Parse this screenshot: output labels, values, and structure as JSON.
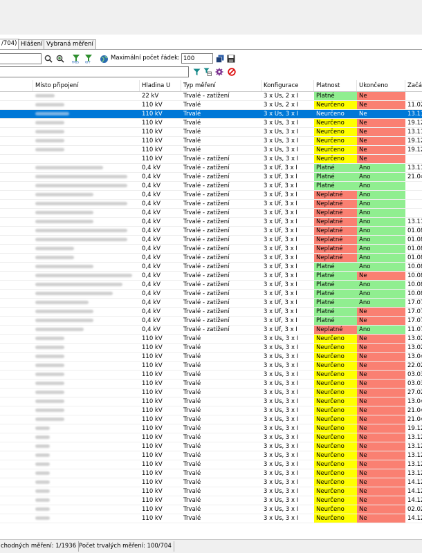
{
  "tabs": [
    {
      "label": "/704)",
      "active": true
    },
    {
      "label": "Hlášení",
      "active": false
    },
    {
      "label": "Vybraná měření",
      "active": false
    }
  ],
  "toolbar": {
    "max_rows_label": "Maximální počet řádek:",
    "max_rows_value": "100",
    "icons": [
      "search-icon",
      "zoom-in-icon",
      "filter-off-icon",
      "filter-off-icon",
      "globe-icon",
      "copy-icon",
      "save-icon",
      "filter-icon",
      "filter-table-icon",
      "settings-icon",
      "cancel-icon"
    ]
  },
  "colors": {
    "selected": "#0078d7",
    "valid": "#90ee90",
    "invalid": "#fa8072",
    "uncertain": "#ffff00"
  },
  "columns": [
    "Místo připojení",
    "Hladina U",
    "Typ měření",
    "Konfigurace",
    "Platnost",
    "Ukončeno",
    "Začát"
  ],
  "rows": [
    {
      "u": "22 kV",
      "typ": "Trvalé - zatížení",
      "konf": "3 x Us, 2 x I",
      "plat": "Platné",
      "ukon": "Ne",
      "zac": "",
      "w": 0.2
    },
    {
      "u": "110 kV",
      "typ": "Trvalé",
      "konf": "3 x Us, 2 x I",
      "plat": "Neurčeno",
      "ukon": "Ne",
      "zac": "11.02",
      "w": 0.3
    },
    {
      "u": "110 kV",
      "typ": "Trvalé",
      "konf": "3 x Us, 3 x I",
      "plat": "Neurčeno",
      "ukon": "Ne",
      "zac": "13.11",
      "w": 0.35,
      "sel": true
    },
    {
      "u": "110 kV",
      "typ": "Trvalé",
      "konf": "3 x Us, 3 x I",
      "plat": "Neurčeno",
      "ukon": "Ne",
      "zac": "19.12",
      "w": 0.3
    },
    {
      "u": "110 kV",
      "typ": "Trvalé",
      "konf": "3 x Us, 3 x I",
      "plat": "Neurčeno",
      "ukon": "Ne",
      "zac": "13.11",
      "w": 0.3
    },
    {
      "u": "110 kV",
      "typ": "Trvalé",
      "konf": "3 x Us, 3 x I",
      "plat": "Neurčeno",
      "ukon": "Ne",
      "zac": "19.12",
      "w": 0.3
    },
    {
      "u": "110 kV",
      "typ": "Trvalé",
      "konf": "3 x Us, 3 x I",
      "plat": "Neurčeno",
      "ukon": "Ne",
      "zac": "19.12",
      "w": 0.3
    },
    {
      "u": "110 kV",
      "typ": "Trvalé - zatížení",
      "konf": "3 x Us, 3 x I",
      "plat": "Neurčeno",
      "ukon": "Ne",
      "zac": "",
      "w": 0
    },
    {
      "u": "0,4 kV",
      "typ": "Trvalé - zatížení",
      "konf": "3 x Uf, 3 x I",
      "plat": "Platné",
      "ukon": "Ano",
      "zac": "13.11",
      "w": 0.7
    },
    {
      "u": "0,4 kV",
      "typ": "Trvalé - zatížení",
      "konf": "3 x Uf, 3 x I",
      "plat": "Platné",
      "ukon": "Ano",
      "zac": "21.04",
      "w": 0.95
    },
    {
      "u": "0,4 kV",
      "typ": "Trvalé - zatížení",
      "konf": "3 x Uf, 3 x I",
      "plat": "Platné",
      "ukon": "Ano",
      "zac": "",
      "w": 0.95
    },
    {
      "u": "0,4 kV",
      "typ": "Trvalé - zatížení",
      "konf": "3 x Uf, 3 x I",
      "plat": "Neplatné",
      "ukon": "Ano",
      "zac": "",
      "w": 0.6
    },
    {
      "u": "0,4 kV",
      "typ": "Trvalé - zatížení",
      "konf": "3 x Uf, 3 x I",
      "plat": "Neplatné",
      "ukon": "Ano",
      "zac": "",
      "w": 0.95
    },
    {
      "u": "0,4 kV",
      "typ": "Trvalé - zatížení",
      "konf": "3 x Uf, 3 x I",
      "plat": "Neplatné",
      "ukon": "Ano",
      "zac": "",
      "w": 0.6
    },
    {
      "u": "0,4 kV",
      "typ": "Trvalé - zatížení",
      "konf": "3 x Uf, 3 x I",
      "plat": "Neplatné",
      "ukon": "Ano",
      "zac": "13.11",
      "w": 0.6
    },
    {
      "u": "0,4 kV",
      "typ": "Trvalé - zatížení",
      "konf": "3 x Uf, 3 x I",
      "plat": "Neplatné",
      "ukon": "Ano",
      "zac": "01.08",
      "w": 0.95
    },
    {
      "u": "0,4 kV",
      "typ": "Trvalé - zatížení",
      "konf": "3 x Uf, 3 x I",
      "plat": "Neplatné",
      "ukon": "Ano",
      "zac": "01.08",
      "w": 0.95
    },
    {
      "u": "0,4 kV",
      "typ": "Trvalé - zatížení",
      "konf": "3 x Uf, 3 x I",
      "plat": "Neplatné",
      "ukon": "Ano",
      "zac": "01.08",
      "w": 0.4
    },
    {
      "u": "0,4 kV",
      "typ": "Trvalé - zatížení",
      "konf": "3 x Uf, 3 x I",
      "plat": "Neplatné",
      "ukon": "Ano",
      "zac": "01.08",
      "w": 0.4
    },
    {
      "u": "0,4 kV",
      "typ": "Trvalé - zatížení",
      "konf": "3 x Uf, 3 x I",
      "plat": "Platné",
      "ukon": "Ano",
      "zac": "10.08",
      "w": 0.6
    },
    {
      "u": "0,4 kV",
      "typ": "Trvalé - zatížení",
      "konf": "3 x Uf, 3 x I",
      "plat": "Platné",
      "ukon": "Ne",
      "zac": "10.08",
      "w": 1.0
    },
    {
      "u": "0,4 kV",
      "typ": "Trvalé - zatížení",
      "konf": "3 x Uf, 3 x I",
      "plat": "Platné",
      "ukon": "Ano",
      "zac": "10.08",
      "w": 0.9
    },
    {
      "u": "0,4 kV",
      "typ": "Trvalé - zatížení",
      "konf": "3 x Uf, 3 x I",
      "plat": "Platné",
      "ukon": "Ano",
      "zac": "10.08",
      "w": 0.8
    },
    {
      "u": "0,4 kV",
      "typ": "Trvalé - zatížení",
      "konf": "3 x Uf, 3 x I",
      "plat": "Platné",
      "ukon": "Ano",
      "zac": "17.07",
      "w": 0.55
    },
    {
      "u": "0,4 kV",
      "typ": "Trvalé - zatížení",
      "konf": "3 x Uf, 3 x I",
      "plat": "Platné",
      "ukon": "Ne",
      "zac": "17.07",
      "w": 0.6
    },
    {
      "u": "0,4 kV",
      "typ": "Trvalé - zatížení",
      "konf": "3 x Uf, 3 x I",
      "plat": "Platné",
      "ukon": "Ne",
      "zac": "17.07",
      "w": 0.6
    },
    {
      "u": "0,4 kV",
      "typ": "Trvalé - zatížení",
      "konf": "3 x Uf, 3 x I",
      "plat": "Neplatné",
      "ukon": "Ano",
      "zac": "11.07",
      "w": 0.5
    },
    {
      "u": "110 kV",
      "typ": "Trvalé",
      "konf": "3 x Us, 3 x I",
      "plat": "Neurčeno",
      "ukon": "Ne",
      "zac": "13.02",
      "w": 0.3
    },
    {
      "u": "110 kV",
      "typ": "Trvalé",
      "konf": "3 x Us, 3 x I",
      "plat": "Neurčeno",
      "ukon": "Ne",
      "zac": "13.02",
      "w": 0.3
    },
    {
      "u": "110 kV",
      "typ": "Trvalé",
      "konf": "3 x Us, 3 x I",
      "plat": "Neurčeno",
      "ukon": "Ne",
      "zac": "13.04",
      "w": 0.3
    },
    {
      "u": "110 kV",
      "typ": "Trvalé",
      "konf": "3 x Us, 3 x I",
      "plat": "Neurčeno",
      "ukon": "Ne",
      "zac": "22.02",
      "w": 0.3
    },
    {
      "u": "110 kV",
      "typ": "Trvalé",
      "konf": "3 x Us, 3 x I",
      "plat": "Neurčeno",
      "ukon": "Ne",
      "zac": "03.03",
      "w": 0.3
    },
    {
      "u": "110 kV",
      "typ": "Trvalé",
      "konf": "3 x Us, 3 x I",
      "plat": "Neurčeno",
      "ukon": "Ne",
      "zac": "03.03",
      "w": 0.3
    },
    {
      "u": "110 kV",
      "typ": "Trvalé",
      "konf": "3 x Us, 3 x I",
      "plat": "Neurčeno",
      "ukon": "Ne",
      "zac": "27.02",
      "w": 0.3
    },
    {
      "u": "110 kV",
      "typ": "Trvalé",
      "konf": "3 x Us, 3 x I",
      "plat": "Neurčeno",
      "ukon": "Ne",
      "zac": "13.04",
      "w": 0.3
    },
    {
      "u": "110 kV",
      "typ": "Trvalé",
      "konf": "3 x Us, 3 x I",
      "plat": "Neurčeno",
      "ukon": "Ne",
      "zac": "21.04",
      "w": 0.3
    },
    {
      "u": "110 kV",
      "typ": "Trvalé",
      "konf": "3 x Us, 3 x I",
      "plat": "Neurčeno",
      "ukon": "Ne",
      "zac": "21.04",
      "w": 0.3
    },
    {
      "u": "110 kV",
      "typ": "Trvalé",
      "konf": "3 x Us, 3 x I",
      "plat": "Neurčeno",
      "ukon": "Ne",
      "zac": "19.12",
      "w": 0.15
    },
    {
      "u": "110 kV",
      "typ": "Trvalé",
      "konf": "3 x Us, 3 x I",
      "plat": "Neurčeno",
      "ukon": "Ne",
      "zac": "13.12",
      "w": 0.15
    },
    {
      "u": "110 kV",
      "typ": "Trvalé",
      "konf": "3 x Us, 3 x I",
      "plat": "Neurčeno",
      "ukon": "Ne",
      "zac": "13.12",
      "w": 0.15
    },
    {
      "u": "110 kV",
      "typ": "Trvalé",
      "konf": "3 x Us, 3 x I",
      "plat": "Neurčeno",
      "ukon": "Ne",
      "zac": "13.12",
      "w": 0.15
    },
    {
      "u": "110 kV",
      "typ": "Trvalé",
      "konf": "3 x Us, 3 x I",
      "plat": "Neurčeno",
      "ukon": "Ne",
      "zac": "13.12",
      "w": 0.15
    },
    {
      "u": "110 kV",
      "typ": "Trvalé",
      "konf": "3 x Us, 3 x I",
      "plat": "Neurčeno",
      "ukon": "Ne",
      "zac": "13.12",
      "w": 0.15
    },
    {
      "u": "110 kV",
      "typ": "Trvalé",
      "konf": "3 x Us, 3 x I",
      "plat": "Neurčeno",
      "ukon": "Ne",
      "zac": "14.12",
      "w": 0.15
    },
    {
      "u": "110 kV",
      "typ": "Trvalé",
      "konf": "3 x Us, 3 x I",
      "plat": "Neurčeno",
      "ukon": "Ne",
      "zac": "14.12",
      "w": 0.15
    },
    {
      "u": "110 kV",
      "typ": "Trvalé",
      "konf": "3 x Us, 3 x I",
      "plat": "Neurčeno",
      "ukon": "Ne",
      "zac": "14.12",
      "w": 0.15
    },
    {
      "u": "110 kV",
      "typ": "Trvalé",
      "konf": "3 x Us, 3 x I",
      "plat": "Neurčeno",
      "ukon": "Ne",
      "zac": "02.02",
      "w": 0.15
    },
    {
      "u": "110 kV",
      "typ": "Trvalé",
      "konf": "3 x Us, 3 x I",
      "plat": "Neurčeno",
      "ukon": "Ne",
      "zac": "14.12",
      "w": 0.15
    }
  ],
  "status": {
    "left": "chodných měření:  1/1936",
    "right": "Počet trvalých měření:  100/704"
  }
}
